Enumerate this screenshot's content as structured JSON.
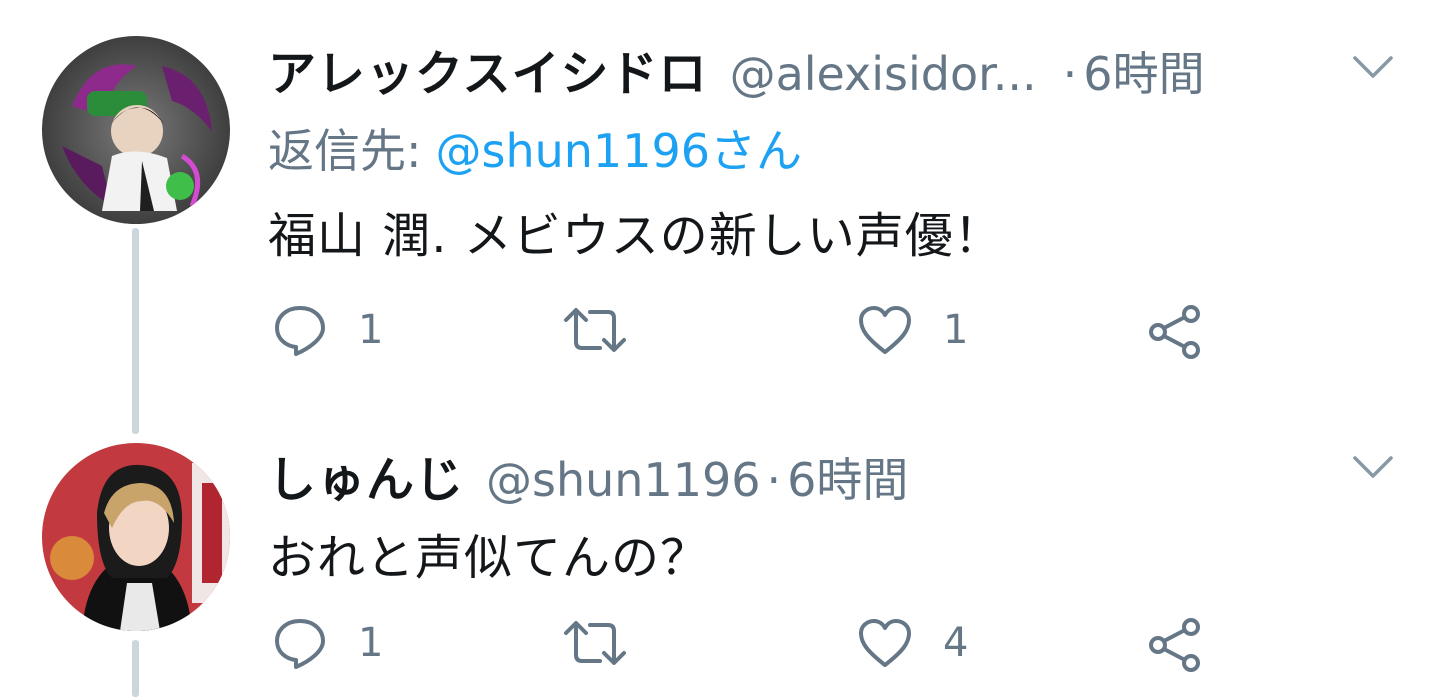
{
  "colors": {
    "text_primary": "#14171a",
    "text_secondary": "#657786",
    "link": "#1da1f2",
    "thread_line": "#ccd6dd"
  },
  "tweets": [
    {
      "display_name": "アレックスイシドロ",
      "handle": "@alexisidor...",
      "separator": "·",
      "time": "6時間",
      "reply_to_label": "返信先:",
      "reply_to_handle": "@shun1196さん",
      "text": "福山 潤. メビウスの新しい声優！",
      "replies": "1",
      "retweets": "",
      "likes": "1",
      "avatar_icon": "avatar-image",
      "menu_icon": "chevron-down-icon"
    },
    {
      "display_name": "しゅんじ",
      "handle": "@shun1196",
      "separator": "·",
      "time": "6時間",
      "text": "おれと声似てんの？",
      "replies": "1",
      "retweets": "",
      "likes": "4",
      "avatar_icon": "avatar-image",
      "menu_icon": "chevron-down-icon"
    }
  ],
  "action_icons": [
    "reply-icon",
    "retweet-icon",
    "like-icon",
    "share-icon"
  ]
}
